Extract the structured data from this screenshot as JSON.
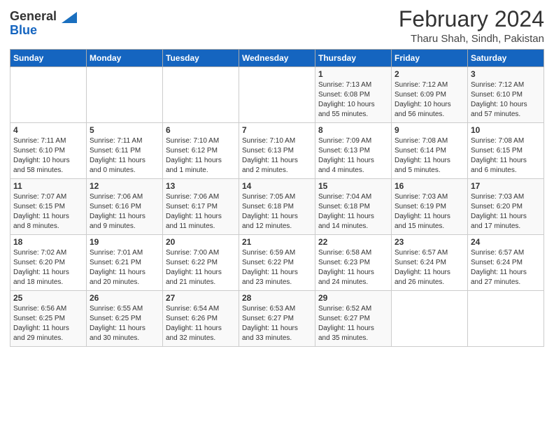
{
  "logo": {
    "line1": "General",
    "line2": "Blue"
  },
  "header": {
    "month": "February 2024",
    "location": "Tharu Shah, Sindh, Pakistan"
  },
  "weekdays": [
    "Sunday",
    "Monday",
    "Tuesday",
    "Wednesday",
    "Thursday",
    "Friday",
    "Saturday"
  ],
  "weeks": [
    [
      {
        "day": "",
        "info": ""
      },
      {
        "day": "",
        "info": ""
      },
      {
        "day": "",
        "info": ""
      },
      {
        "day": "",
        "info": ""
      },
      {
        "day": "1",
        "info": "Sunrise: 7:13 AM\nSunset: 6:08 PM\nDaylight: 10 hours\nand 55 minutes."
      },
      {
        "day": "2",
        "info": "Sunrise: 7:12 AM\nSunset: 6:09 PM\nDaylight: 10 hours\nand 56 minutes."
      },
      {
        "day": "3",
        "info": "Sunrise: 7:12 AM\nSunset: 6:10 PM\nDaylight: 10 hours\nand 57 minutes."
      }
    ],
    [
      {
        "day": "4",
        "info": "Sunrise: 7:11 AM\nSunset: 6:10 PM\nDaylight: 10 hours\nand 58 minutes."
      },
      {
        "day": "5",
        "info": "Sunrise: 7:11 AM\nSunset: 6:11 PM\nDaylight: 11 hours\nand 0 minutes."
      },
      {
        "day": "6",
        "info": "Sunrise: 7:10 AM\nSunset: 6:12 PM\nDaylight: 11 hours\nand 1 minute."
      },
      {
        "day": "7",
        "info": "Sunrise: 7:10 AM\nSunset: 6:13 PM\nDaylight: 11 hours\nand 2 minutes."
      },
      {
        "day": "8",
        "info": "Sunrise: 7:09 AM\nSunset: 6:13 PM\nDaylight: 11 hours\nand 4 minutes."
      },
      {
        "day": "9",
        "info": "Sunrise: 7:08 AM\nSunset: 6:14 PM\nDaylight: 11 hours\nand 5 minutes."
      },
      {
        "day": "10",
        "info": "Sunrise: 7:08 AM\nSunset: 6:15 PM\nDaylight: 11 hours\nand 6 minutes."
      }
    ],
    [
      {
        "day": "11",
        "info": "Sunrise: 7:07 AM\nSunset: 6:15 PM\nDaylight: 11 hours\nand 8 minutes."
      },
      {
        "day": "12",
        "info": "Sunrise: 7:06 AM\nSunset: 6:16 PM\nDaylight: 11 hours\nand 9 minutes."
      },
      {
        "day": "13",
        "info": "Sunrise: 7:06 AM\nSunset: 6:17 PM\nDaylight: 11 hours\nand 11 minutes."
      },
      {
        "day": "14",
        "info": "Sunrise: 7:05 AM\nSunset: 6:18 PM\nDaylight: 11 hours\nand 12 minutes."
      },
      {
        "day": "15",
        "info": "Sunrise: 7:04 AM\nSunset: 6:18 PM\nDaylight: 11 hours\nand 14 minutes."
      },
      {
        "day": "16",
        "info": "Sunrise: 7:03 AM\nSunset: 6:19 PM\nDaylight: 11 hours\nand 15 minutes."
      },
      {
        "day": "17",
        "info": "Sunrise: 7:03 AM\nSunset: 6:20 PM\nDaylight: 11 hours\nand 17 minutes."
      }
    ],
    [
      {
        "day": "18",
        "info": "Sunrise: 7:02 AM\nSunset: 6:20 PM\nDaylight: 11 hours\nand 18 minutes."
      },
      {
        "day": "19",
        "info": "Sunrise: 7:01 AM\nSunset: 6:21 PM\nDaylight: 11 hours\nand 20 minutes."
      },
      {
        "day": "20",
        "info": "Sunrise: 7:00 AM\nSunset: 6:22 PM\nDaylight: 11 hours\nand 21 minutes."
      },
      {
        "day": "21",
        "info": "Sunrise: 6:59 AM\nSunset: 6:22 PM\nDaylight: 11 hours\nand 23 minutes."
      },
      {
        "day": "22",
        "info": "Sunrise: 6:58 AM\nSunset: 6:23 PM\nDaylight: 11 hours\nand 24 minutes."
      },
      {
        "day": "23",
        "info": "Sunrise: 6:57 AM\nSunset: 6:24 PM\nDaylight: 11 hours\nand 26 minutes."
      },
      {
        "day": "24",
        "info": "Sunrise: 6:57 AM\nSunset: 6:24 PM\nDaylight: 11 hours\nand 27 minutes."
      }
    ],
    [
      {
        "day": "25",
        "info": "Sunrise: 6:56 AM\nSunset: 6:25 PM\nDaylight: 11 hours\nand 29 minutes."
      },
      {
        "day": "26",
        "info": "Sunrise: 6:55 AM\nSunset: 6:25 PM\nDaylight: 11 hours\nand 30 minutes."
      },
      {
        "day": "27",
        "info": "Sunrise: 6:54 AM\nSunset: 6:26 PM\nDaylight: 11 hours\nand 32 minutes."
      },
      {
        "day": "28",
        "info": "Sunrise: 6:53 AM\nSunset: 6:27 PM\nDaylight: 11 hours\nand 33 minutes."
      },
      {
        "day": "29",
        "info": "Sunrise: 6:52 AM\nSunset: 6:27 PM\nDaylight: 11 hours\nand 35 minutes."
      },
      {
        "day": "",
        "info": ""
      },
      {
        "day": "",
        "info": ""
      }
    ]
  ]
}
